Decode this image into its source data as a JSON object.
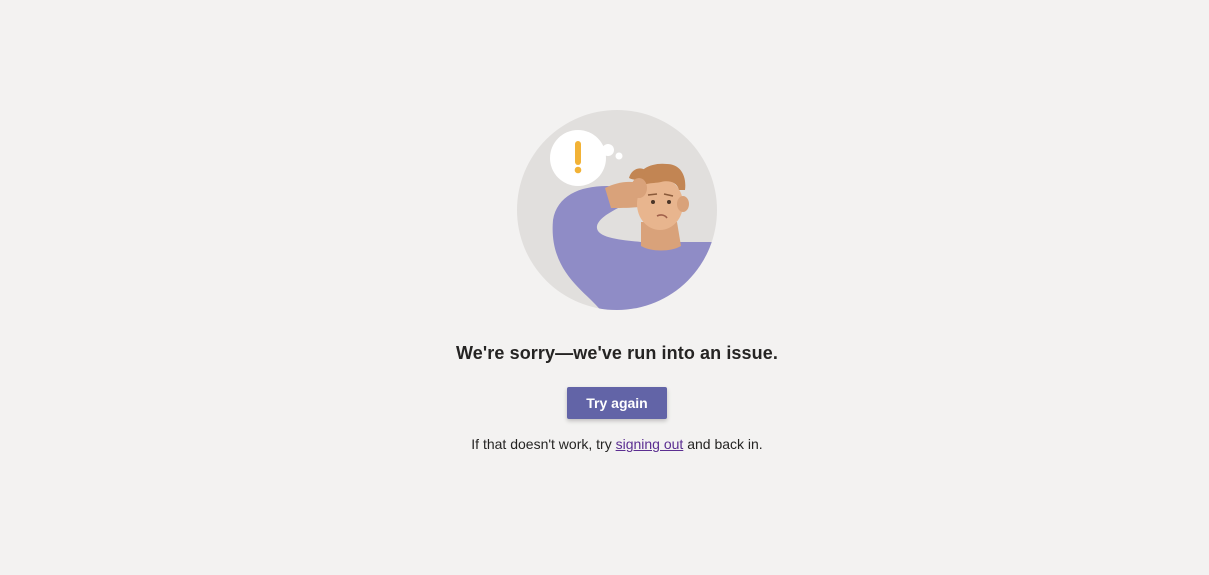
{
  "error": {
    "heading": "We're sorry—we've run into an issue.",
    "try_again_label": "Try again",
    "help_prefix": "If that doesn't work, try ",
    "help_link_label": "signing out",
    "help_suffix": " and back in."
  },
  "illustration": {
    "icon": "confused-person-illustration",
    "thought_symbol": "!"
  },
  "colors": {
    "background": "#f3f2f1",
    "accent": "#6264a7",
    "link": "#5b2e91",
    "text": "#252423",
    "shirt": "#8f8cc6",
    "warning": "#f2b236"
  }
}
